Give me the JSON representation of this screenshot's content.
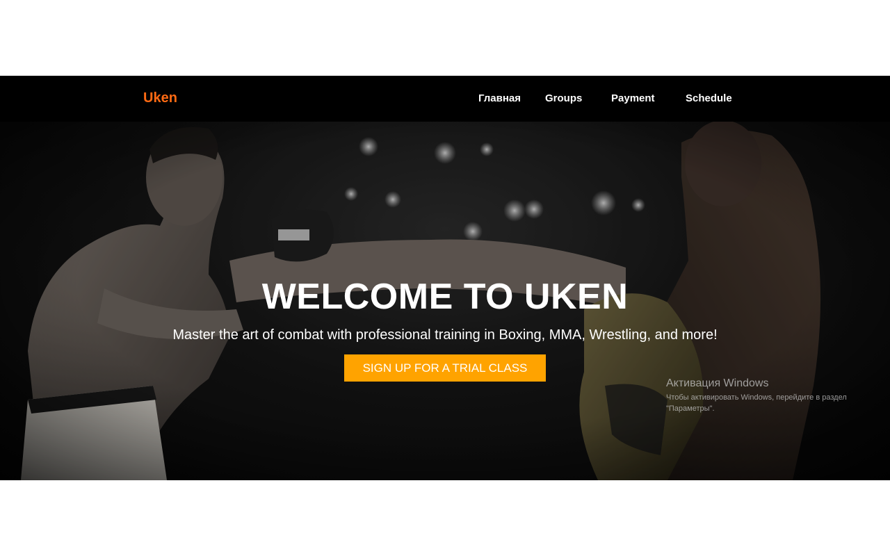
{
  "header": {
    "logo": "Uken",
    "nav": [
      {
        "label": "Главная"
      },
      {
        "label": "Groups"
      },
      {
        "label": "Payment"
      },
      {
        "label": "Schedule"
      }
    ]
  },
  "hero": {
    "title": "WELCOME TO UKEN",
    "subtitle": "Master the art of combat with professional training in Boxing, MMA, Wrestling, and more!",
    "cta_label": "SIGN UP FOR A TRIAL CLASS",
    "background_image": "mma-fight-photo"
  },
  "os_overlay": {
    "title": "Активация Windows",
    "text": "Чтобы активировать Windows, перейдите в раздел \"Параметры\"."
  },
  "colors": {
    "logo": "#ff6a13",
    "cta": "#ffa300",
    "nav_background": "#000000",
    "text": "#ffffff"
  }
}
